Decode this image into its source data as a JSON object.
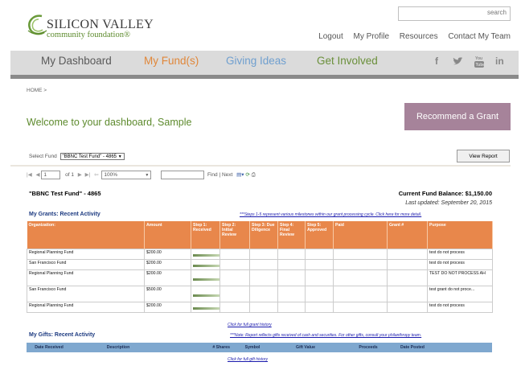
{
  "logo": {
    "line1": "SILICON VALLEY",
    "line2": "community foundation",
    "reg": "®"
  },
  "search": {
    "placeholder": "",
    "button_label": "search"
  },
  "top_links": [
    "Logout",
    "My Profile",
    "Resources",
    "Contact My Team"
  ],
  "nav": [
    {
      "label": "My Dashboard",
      "color": "#5a5a5a"
    },
    {
      "label": "My Fund(s)",
      "color": "#e0873a"
    },
    {
      "label": "Giving Ideas",
      "color": "#6f9fcf"
    },
    {
      "label": "Get Involved",
      "color": "#6a8f3a"
    }
  ],
  "social_icons": [
    "facebook-icon",
    "twitter-icon",
    "youtube-icon",
    "linkedin-icon"
  ],
  "breadcrumb": "HOME >",
  "welcome": "Welcome to your dashboard, Sample",
  "recommend_button": "Recommend a Grant",
  "select_fund": {
    "label": "Select Fund",
    "value": "\"BBNC Test Fund\" - 4865"
  },
  "view_report": "View Report",
  "report_toolbar": {
    "page_value": "1",
    "page_of": "of 1",
    "zoom": "100%",
    "find_value": "",
    "find_label": "Find",
    "next_label": "Next",
    "sep": "|"
  },
  "fund_name": "\"BBNC Test Fund\" - 4865",
  "balance": "Current Fund Balance:  $1,150.00",
  "last_updated": "Last updated: September 20,  2015",
  "grants": {
    "title": "My Grants: Recent Activity",
    "note": "***Steps 1-5 represent various milestones within our grant processing cycle.  Click here for more detail.",
    "headers": [
      "Organization:",
      "Amount",
      "Step 1: Received",
      "Step 2: Initial Review",
      "Step 3: Due Diligence",
      "Step 4: Final Review",
      "Step 5: Approved",
      "Paid",
      "Grant #",
      "Purpose"
    ],
    "rows": [
      {
        "org": "Regional Planning Fund",
        "amount": "$200.00",
        "progress_steps": 1,
        "purpose": "test do not process"
      },
      {
        "org": "San Francisco Fund",
        "amount": "$200.00",
        "progress_steps": 1,
        "purpose": "test do not process"
      },
      {
        "org": "Regional Planning Fund",
        "amount": "$200.00",
        "progress_steps": 1,
        "purpose": "TEST DO NOT PROCESS AH"
      },
      {
        "org": "San Francisco Fund",
        "amount": "$500.00",
        "progress_steps": 1,
        "purpose": "test grant do not proce..."
      },
      {
        "org": "Regional Planning Fund",
        "amount": "$200.00",
        "progress_steps": 1,
        "purpose": "test do not process"
      }
    ],
    "history_link": "Click for full grant history"
  },
  "gifts": {
    "title": "My Gifts: Recent Activity",
    "note": "***Note: Report reflects gifts received of cash and securities.  For other gifts, consult your philanthropy team.",
    "headers": [
      "Date Received",
      "Description",
      "# Shares",
      "Symbol",
      "Gift Value",
      "Proceeds",
      "Date Posted"
    ],
    "history_link": "Click for full gift history"
  }
}
